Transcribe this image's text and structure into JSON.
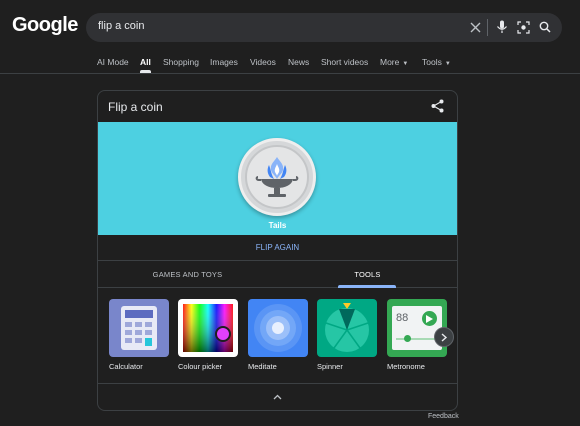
{
  "header": {
    "logo": "Google",
    "search_value": "flip a coin"
  },
  "nav_tabs": [
    {
      "label": "AI Mode"
    },
    {
      "label": "All"
    },
    {
      "label": "Shopping"
    },
    {
      "label": "Images"
    },
    {
      "label": "Videos"
    },
    {
      "label": "News"
    },
    {
      "label": "Short videos"
    },
    {
      "label": "More"
    },
    {
      "label": "Tools"
    }
  ],
  "active_tab": "All",
  "card": {
    "title": "Flip a coin",
    "result": "Tails",
    "flip_again": "FLIP AGAIN",
    "stage_color": "#4dd0e1",
    "category_tabs": [
      {
        "label": "GAMES AND TOYS"
      },
      {
        "label": "TOOLS"
      }
    ],
    "active_category": "TOOLS",
    "tools": [
      {
        "label": "Calculator",
        "icon": "calculator-icon",
        "color": "#7986cb"
      },
      {
        "label": "Colour picker",
        "icon": "colour-picker-icon",
        "color": "#ffffff"
      },
      {
        "label": "Meditate",
        "icon": "meditate-icon",
        "color": "#4285f4"
      },
      {
        "label": "Spinner",
        "icon": "spinner-icon",
        "color": "#00a884"
      },
      {
        "label": "Metronome",
        "icon": "metronome-icon",
        "color": "#34a853",
        "readout": "88"
      }
    ]
  },
  "footer": {
    "feedback": "Feedback"
  }
}
